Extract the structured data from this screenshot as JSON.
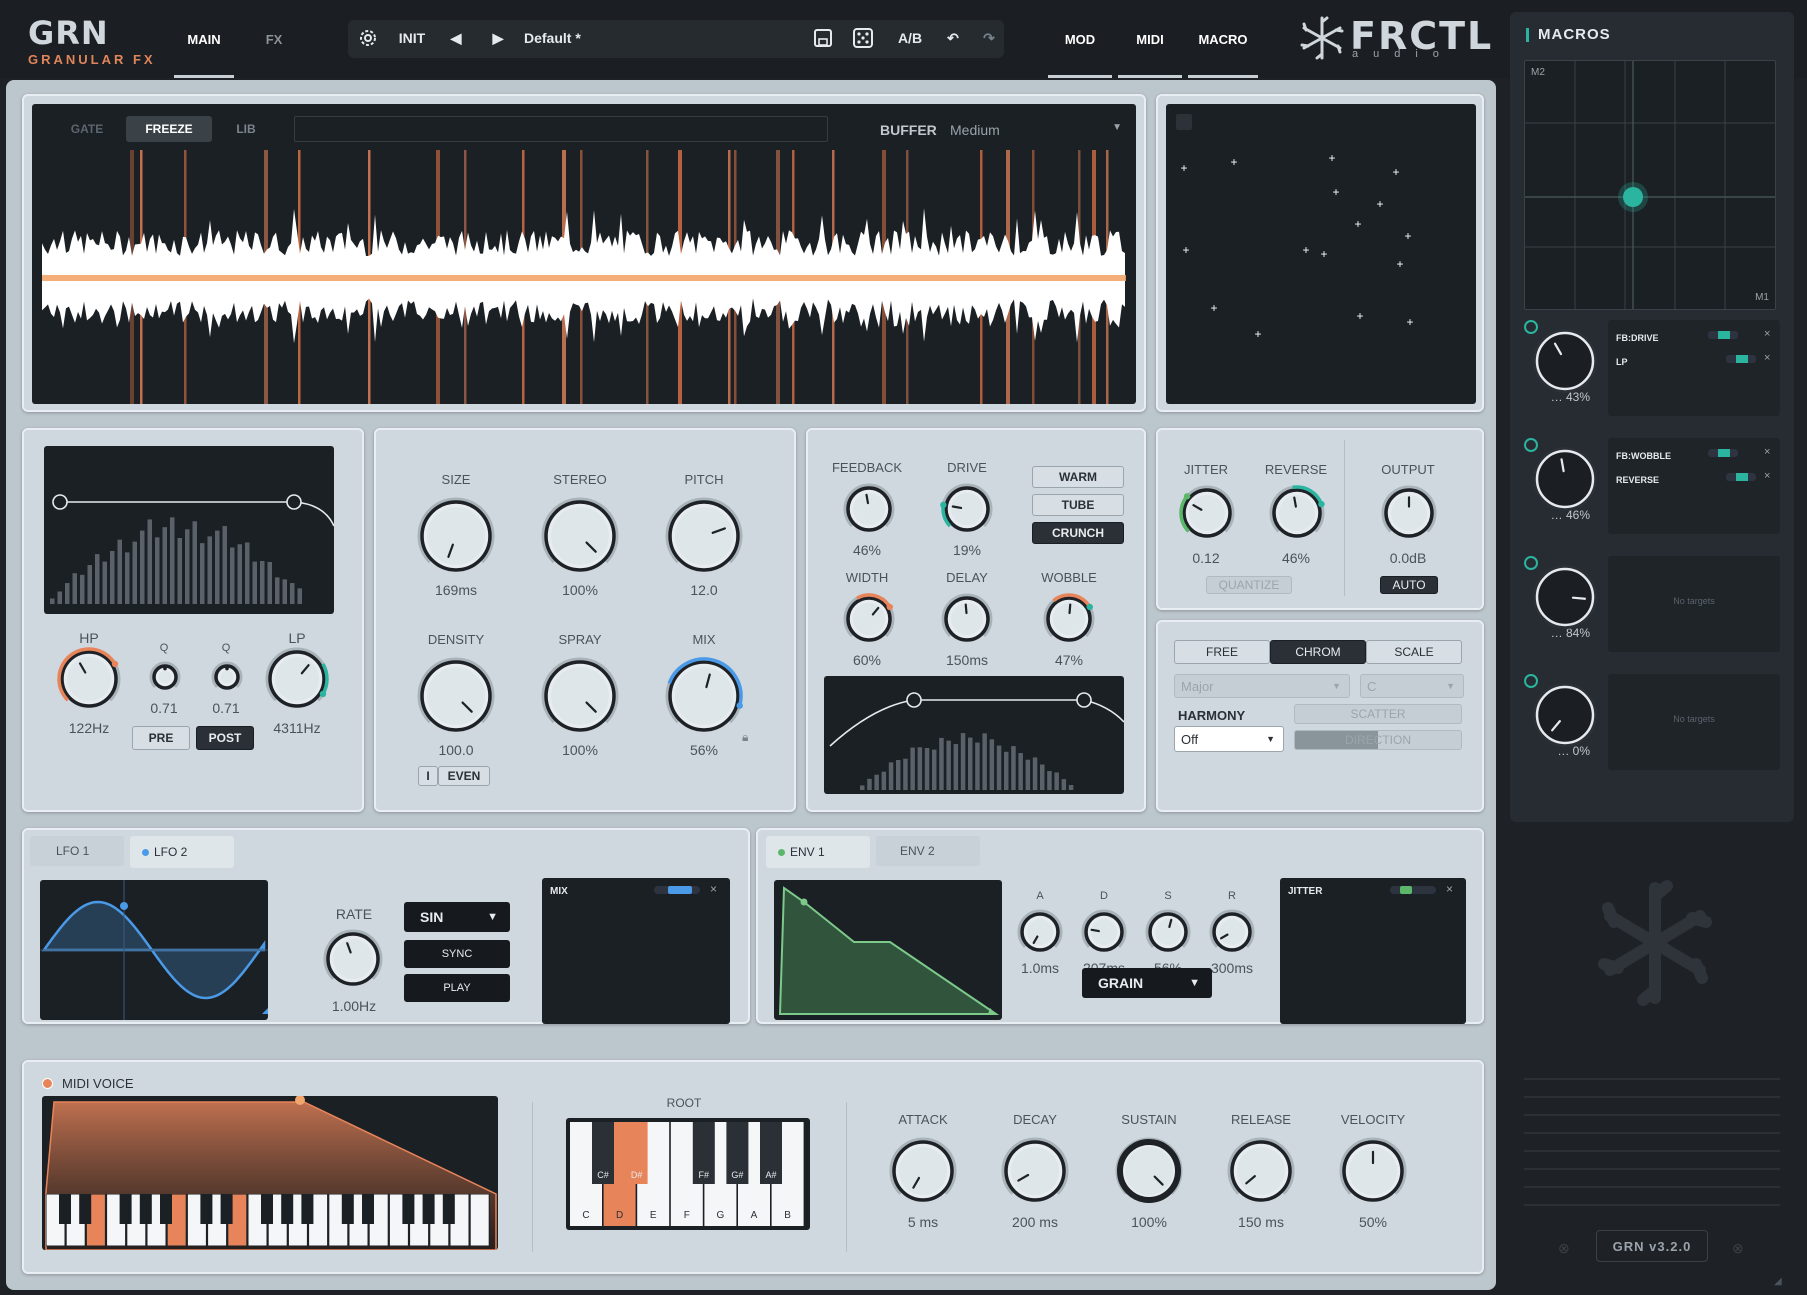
{
  "header": {
    "logo": "GRN",
    "logo_sub": "GRANULAR FX",
    "tabs": [
      "MAIN",
      "FX"
    ],
    "preset_init": "INIT",
    "preset_name": "Default *",
    "ab": "A/B",
    "right_tabs": [
      "MOD",
      "MIDI",
      "MACRO"
    ],
    "brand": "FRCTL",
    "brand_sub": "audio"
  },
  "sampler": {
    "modes": [
      "GATE",
      "FREEZE",
      "LIB"
    ],
    "buffer_label": "BUFFER",
    "buffer_value": "Medium"
  },
  "filter": {
    "hp_label": "HP",
    "hp_value": "122Hz",
    "q1_label": "Q",
    "q1_value": "0.71",
    "q2_label": "Q",
    "q2_value": "0.71",
    "lp_label": "LP",
    "lp_value": "4311Hz",
    "pre": "PRE",
    "post": "POST"
  },
  "grain": {
    "size_label": "SIZE",
    "size_value": "169ms",
    "stereo_label": "STEREO",
    "stereo_value": "100%",
    "pitch_label": "PITCH",
    "pitch_value": "12.0",
    "density_label": "DENSITY",
    "density_value": "100.0",
    "spray_label": "SPRAY",
    "spray_value": "100%",
    "mix_label": "MIX",
    "mix_value": "56%",
    "toggle_i": "I",
    "toggle_even": "EVEN"
  },
  "fx": {
    "feedback_label": "FEEDBACK",
    "feedback_value": "46%",
    "drive_label": "DRIVE",
    "drive_value": "19%",
    "width_label": "WIDTH",
    "width_value": "60%",
    "delay_label": "DELAY",
    "delay_value": "150ms",
    "wobble_label": "WOBBLE",
    "wobble_value": "47%",
    "modes": [
      "WARM",
      "TUBE",
      "CRUNCH"
    ]
  },
  "jitter": {
    "jitter_label": "JITTER",
    "jitter_value": "0.12",
    "reverse_label": "REVERSE",
    "reverse_value": "46%",
    "output_label": "OUTPUT",
    "output_value": "0.0dB",
    "quantize": "QUANTIZE",
    "auto": "AUTO"
  },
  "pitchmode": {
    "tabs": [
      "FREE",
      "CHROM",
      "SCALE"
    ],
    "scale": "Major",
    "key": "C",
    "harmony_label": "HARMONY",
    "harmony_value": "Off",
    "scatter": "SCATTER",
    "direction": "DIRECTION"
  },
  "lfo": {
    "tabs": [
      "LFO 1",
      "LFO 2"
    ],
    "rate_label": "RATE",
    "rate_value": "1.00Hz",
    "wave": "SIN",
    "sync": "SYNC",
    "play": "PLAY",
    "target": "MIX"
  },
  "env": {
    "tabs": [
      "ENV 1",
      "ENV 2"
    ],
    "a_label": "A",
    "a_value": "1.0ms",
    "d_label": "D",
    "d_value": "207ms",
    "s_label": "S",
    "s_value": "56%",
    "r_label": "R",
    "r_value": "300ms",
    "mode": "GRAIN",
    "target": "JITTER"
  },
  "midi": {
    "title": "MIDI VOICE",
    "root_label": "ROOT",
    "black_keys": [
      "C#",
      "D#",
      "F#",
      "G#",
      "A#"
    ],
    "white_keys": [
      "C",
      "D",
      "E",
      "F",
      "G",
      "A",
      "B"
    ],
    "attack_label": "ATTACK",
    "attack_value": "5 ms",
    "decay_label": "DECAY",
    "decay_value": "200 ms",
    "sustain_label": "SUSTAIN",
    "sustain_value": "100%",
    "release_label": "RELEASE",
    "release_value": "150 ms",
    "velocity_label": "VELOCITY",
    "velocity_value": "50%"
  },
  "macros": {
    "title": "MACROS",
    "xy_y": "M2",
    "xy_x": "M1",
    "items": [
      {
        "value": "43%",
        "targets": [
          "FB:DRIVE",
          "LP"
        ]
      },
      {
        "value": "46%",
        "targets": [
          "FB:WOBBLE",
          "REVERSE"
        ]
      },
      {
        "value": "84%",
        "empty": "No targets"
      },
      {
        "value": "0%",
        "empty": "No targets"
      }
    ]
  },
  "footer": {
    "version": "GRN v3.2.0"
  },
  "colors": {
    "accent_orange": "#e8845a",
    "accent_teal": "#2bb5a0",
    "accent_blue": "#4a9ae8"
  }
}
